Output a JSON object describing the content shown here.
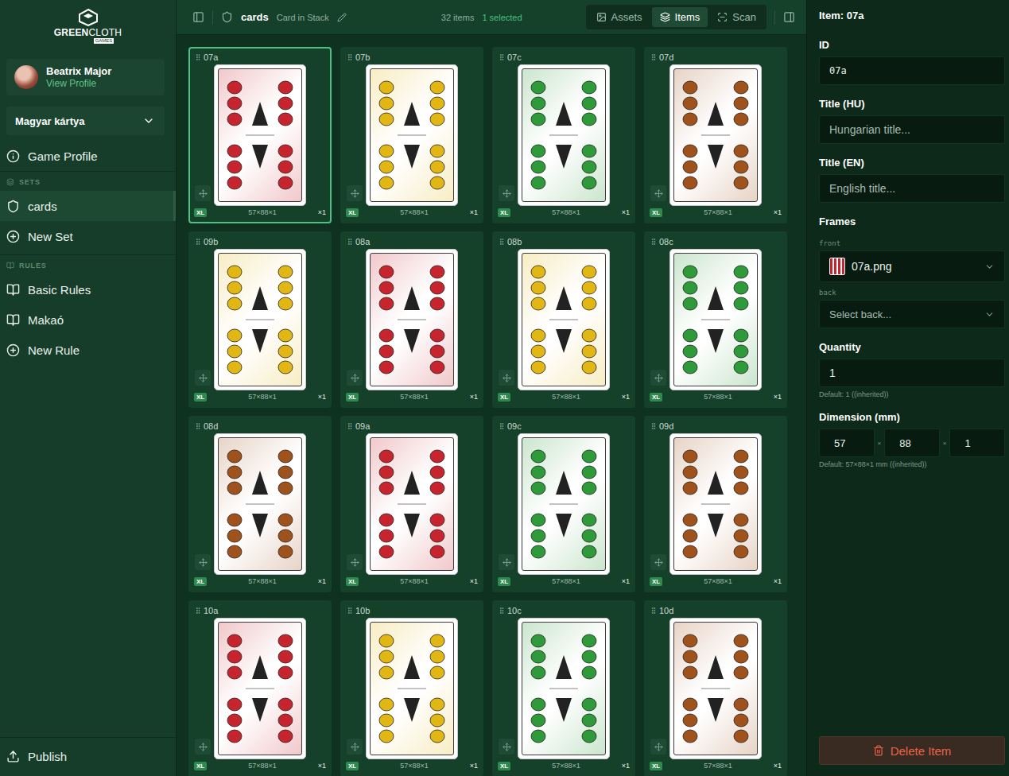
{
  "logo": {
    "bold": "GREEN",
    "light": "CLOTH",
    "sub": "GAMES"
  },
  "user": {
    "name": "Beatrix Major",
    "link": "View Profile"
  },
  "game_select": {
    "value": "Magyar kártya"
  },
  "sidebar": {
    "top_item": {
      "label": "Game Profile"
    },
    "sections": [
      {
        "title": "SETS",
        "kind": "sets",
        "items": [
          {
            "label": "cards",
            "kind": "set",
            "selected": true
          },
          {
            "label": "New Set",
            "kind": "add",
            "selected": false
          }
        ]
      },
      {
        "title": "RULES",
        "kind": "rules",
        "items": [
          {
            "label": "Basic Rules",
            "kind": "rule",
            "selected": false
          },
          {
            "label": "Makaó",
            "kind": "rule",
            "selected": false
          },
          {
            "label": "New Rule",
            "kind": "add",
            "selected": false
          }
        ]
      }
    ],
    "footer": {
      "label": "Publish"
    }
  },
  "toolbar": {
    "set_name": "cards",
    "set_type": "Card in Stack",
    "count": "32 items",
    "selection": "1 selected",
    "tabs": [
      {
        "label": "Assets",
        "kind": "assets",
        "selected": false
      },
      {
        "label": "Items",
        "kind": "items",
        "selected": true
      },
      {
        "label": "Scan",
        "kind": "scan",
        "selected": false
      }
    ]
  },
  "items": [
    {
      "id": "07a",
      "size": "XL",
      "dims": "57×88×1",
      "qty": "×1",
      "selected": true,
      "color": "#c8242e"
    },
    {
      "id": "07b",
      "size": "XL",
      "dims": "57×88×1",
      "qty": "×1",
      "selected": false,
      "color": "#e2b714"
    },
    {
      "id": "07c",
      "size": "XL",
      "dims": "57×88×1",
      "qty": "×1",
      "selected": false,
      "color": "#2e9a3a"
    },
    {
      "id": "07d",
      "size": "XL",
      "dims": "57×88×1",
      "qty": "×1",
      "selected": false,
      "color": "#a0521c"
    },
    {
      "id": "09b",
      "size": "XL",
      "dims": "57×88×1",
      "qty": "×1",
      "selected": false,
      "color": "#e2b714"
    },
    {
      "id": "08a",
      "size": "XL",
      "dims": "57×88×1",
      "qty": "×1",
      "selected": false,
      "color": "#c8242e"
    },
    {
      "id": "08b",
      "size": "XL",
      "dims": "57×88×1",
      "qty": "×1",
      "selected": false,
      "color": "#e2b714"
    },
    {
      "id": "08c",
      "size": "XL",
      "dims": "57×88×1",
      "qty": "×1",
      "selected": false,
      "color": "#2e9a3a"
    },
    {
      "id": "08d",
      "size": "XL",
      "dims": "57×88×1",
      "qty": "×1",
      "selected": false,
      "color": "#a0521c"
    },
    {
      "id": "09a",
      "size": "XL",
      "dims": "57×88×1",
      "qty": "×1",
      "selected": false,
      "color": "#c8242e"
    },
    {
      "id": "09c",
      "size": "XL",
      "dims": "57×88×1",
      "qty": "×1",
      "selected": false,
      "color": "#2e9a3a"
    },
    {
      "id": "09d",
      "size": "XL",
      "dims": "57×88×1",
      "qty": "×1",
      "selected": false,
      "color": "#a0521c"
    },
    {
      "id": "10a",
      "size": "XL",
      "dims": "57×88×1",
      "qty": "×1",
      "selected": false,
      "color": "#c8242e"
    },
    {
      "id": "10b",
      "size": "XL",
      "dims": "57×88×1",
      "qty": "×1",
      "selected": false,
      "color": "#e2b714"
    },
    {
      "id": "10c",
      "size": "XL",
      "dims": "57×88×1",
      "qty": "×1",
      "selected": false,
      "color": "#2e9a3a"
    },
    {
      "id": "10d",
      "size": "XL",
      "dims": "57×88×1",
      "qty": "×1",
      "selected": false,
      "color": "#a0521c"
    }
  ],
  "inspector": {
    "title": "Item: 07a",
    "id": {
      "label": "ID",
      "value": "07a"
    },
    "title_hu": {
      "label": "Title (HU)",
      "placeholder": "Hungarian title..."
    },
    "title_en": {
      "label": "Title (EN)",
      "placeholder": "English title..."
    },
    "frames": {
      "label": "Frames",
      "front": {
        "label": "front",
        "value": "07a.png"
      },
      "back": {
        "label": "back",
        "placeholder": "Select back..."
      }
    },
    "quantity": {
      "label": "Quantity",
      "value": "1",
      "hint": "Default: 1 ((inherited))"
    },
    "dimension": {
      "label": "Dimension (mm)",
      "values": [
        "57",
        "88",
        "1"
      ],
      "separator": "×",
      "hint": "Default: 57×88×1 mm ((inherited))"
    },
    "delete": "Delete Item"
  }
}
